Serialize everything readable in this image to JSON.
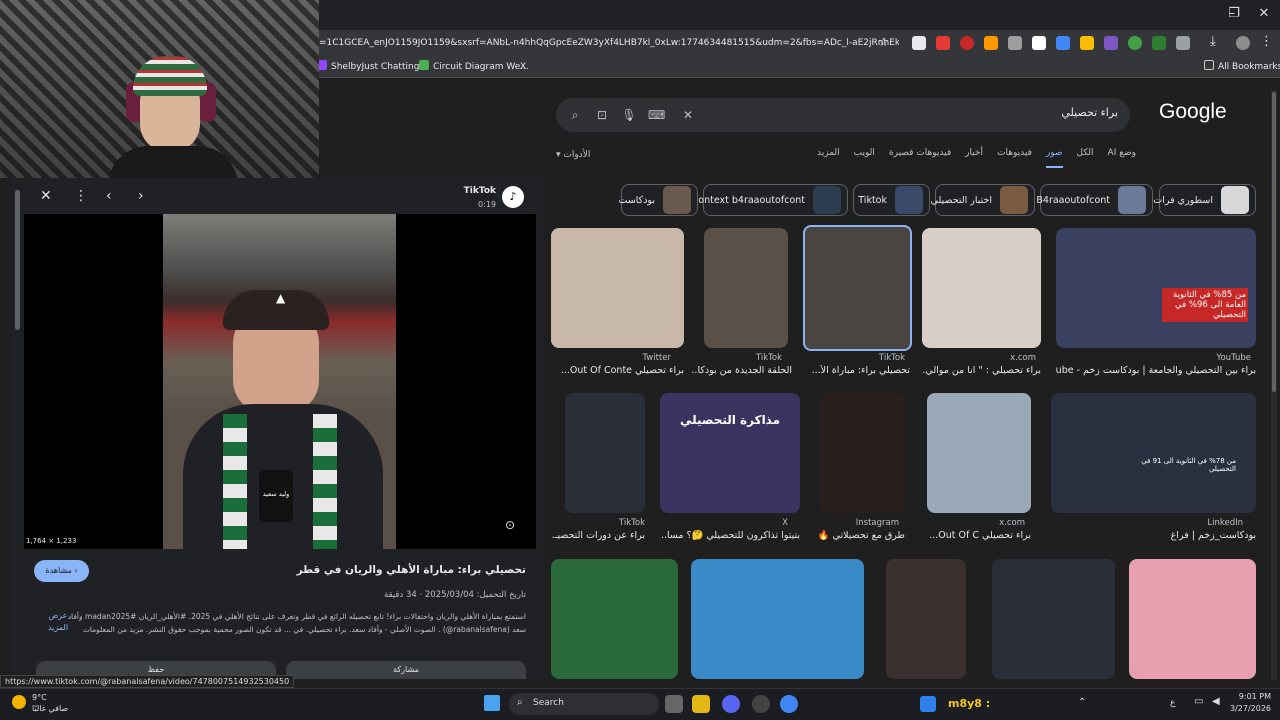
{
  "browser": {
    "url": "=1C1GCEA_enJO1159JO1159&sxsrf=ANbL-n4hhQqGpcEeZW3yXf4LHB7kl_0xLw:1774634481515&udm=2&fbs=ADc_l-aE2jRnhEk2zd...",
    "window_controls": {
      "minimize": "–",
      "maximize": "❐",
      "close": "✕"
    },
    "bookmarks": [
      {
        "label": "ShelbyJust Chatting...",
        "color": "#9146ff"
      },
      {
        "label": "Circuit Diagram We...",
        "color": "#4caf50"
      },
      {
        "label": "X",
        "color": "#ffffff"
      }
    ],
    "all_bookmarks": "All Bookmarks"
  },
  "google": {
    "logo": "Google",
    "query": "براء تحصيلي",
    "tabs": [
      "وضع AI",
      "الكل",
      "صور",
      "فيديوهات",
      "أخبار",
      "فيديوهات قصيرة",
      "الويب",
      "المزيد"
    ],
    "active_tab": "صور",
    "tools": "الأدوات"
  },
  "chips": [
    {
      "label": "اسطوري فرات",
      "color": "#d8d8d8"
    },
    {
      "label": "B4raaoutofcont",
      "color": "#6b7a99"
    },
    {
      "label": "اختبار التحصيلي",
      "color": "#7a5a40"
    },
    {
      "label": "Tiktok",
      "color": "#3a4a6a"
    },
    {
      "label": "Context b4raaoutofcont",
      "color": "#2c3e50"
    },
    {
      "label": "بودكاست",
      "color": "#6a5a50"
    }
  ],
  "results": {
    "row1": [
      {
        "source": "Twitter",
        "caption": "براء تحصيلي Out Of Conte...",
        "color": "#c8b8a8"
      },
      {
        "source": "TikTok",
        "caption": "الحلقة الجديدة من بودكا...",
        "color": "#5a5048"
      },
      {
        "source": "TikTok",
        "caption": "تحصيلي براء: مباراة الأ...",
        "color": "#4a4540"
      },
      {
        "source": "x.com",
        "caption": "براء تحصيلي : \" انا من موالي...",
        "color": "#d8d0c8"
      },
      {
        "source": "YouTube",
        "caption": "براء بين التحصيلي والجامعة | بودكاست زخم - ube...",
        "color": "#3a4060",
        "overlay": "من 85% في الثانوية العامة الى 96% في التحصيلي"
      }
    ],
    "row2": [
      {
        "source": "TikTok",
        "caption": "براء عن دورات التحصيـ...",
        "color": "#2a2e38"
      },
      {
        "source": "X",
        "caption": "بتيتوا تذاكرون للتحصيلي 🤔؟ مسا...",
        "color": "#3a3560",
        "overlay": "مذاكرة التحصيلي"
      },
      {
        "source": "Instagram",
        "caption": "طرق مع تحصيلاتي 🔥",
        "color": "#2a1f1c"
      },
      {
        "source": "x.com",
        "caption": "براء تحصيلي Out Of C...",
        "color": "#9aa8b8"
      },
      {
        "source": "LinkedIn",
        "caption": "بودكاست_زخم | فراغ",
        "color": "#2a3040",
        "overlay": "من 78% في الثانوية الى 91 في التحصيلي"
      }
    ],
    "row3_colors": [
      "#2a6a3a",
      "#3a8ac8",
      "#3a3030",
      "#2a2e38",
      "#e8a0b0"
    ]
  },
  "panel": {
    "source_name": "TikTok",
    "duration": "0:19",
    "dimensions": "1,764 × 1,233",
    "mic_label": "وليد سعيد",
    "visit_label": "مشاهدة",
    "title": "تحصيلي براء: مباراة الأهلي والريان في قطر",
    "meta_date_label": "تاريخ التحميل:",
    "meta_date": "2025/03/04",
    "meta_duration": "34 دقيقة",
    "description": "استمتع بمباراة الأهلي والريان واحتفالات براء! تابع تحصيله الرائع في قطر وتعرف على نتائج الأهلي في 2025. #الأهلي_الريان #madan2025 وأفاد سعد (rabanalsafena@) . الصوت الأصلي - وأفاد سعد. براء تحصيلي. في ... قد تكون الصور محمية بموجب حقوق النشر. مزيد من المعلومات",
    "show_more": "عرض المزيد",
    "share_label": "مشاركة",
    "save_label": "حفظ"
  },
  "status_url": "https://www.tiktok.com/@rabanalsafena/video/7478007514932530450",
  "taskbar": {
    "temperature": "9°C",
    "weather": "صافي غالبًا",
    "search_placeholder": "Search",
    "chat_label": "m8y8 :",
    "time": "9:01 PM",
    "date": "3/27/2026",
    "lang": "ع"
  }
}
